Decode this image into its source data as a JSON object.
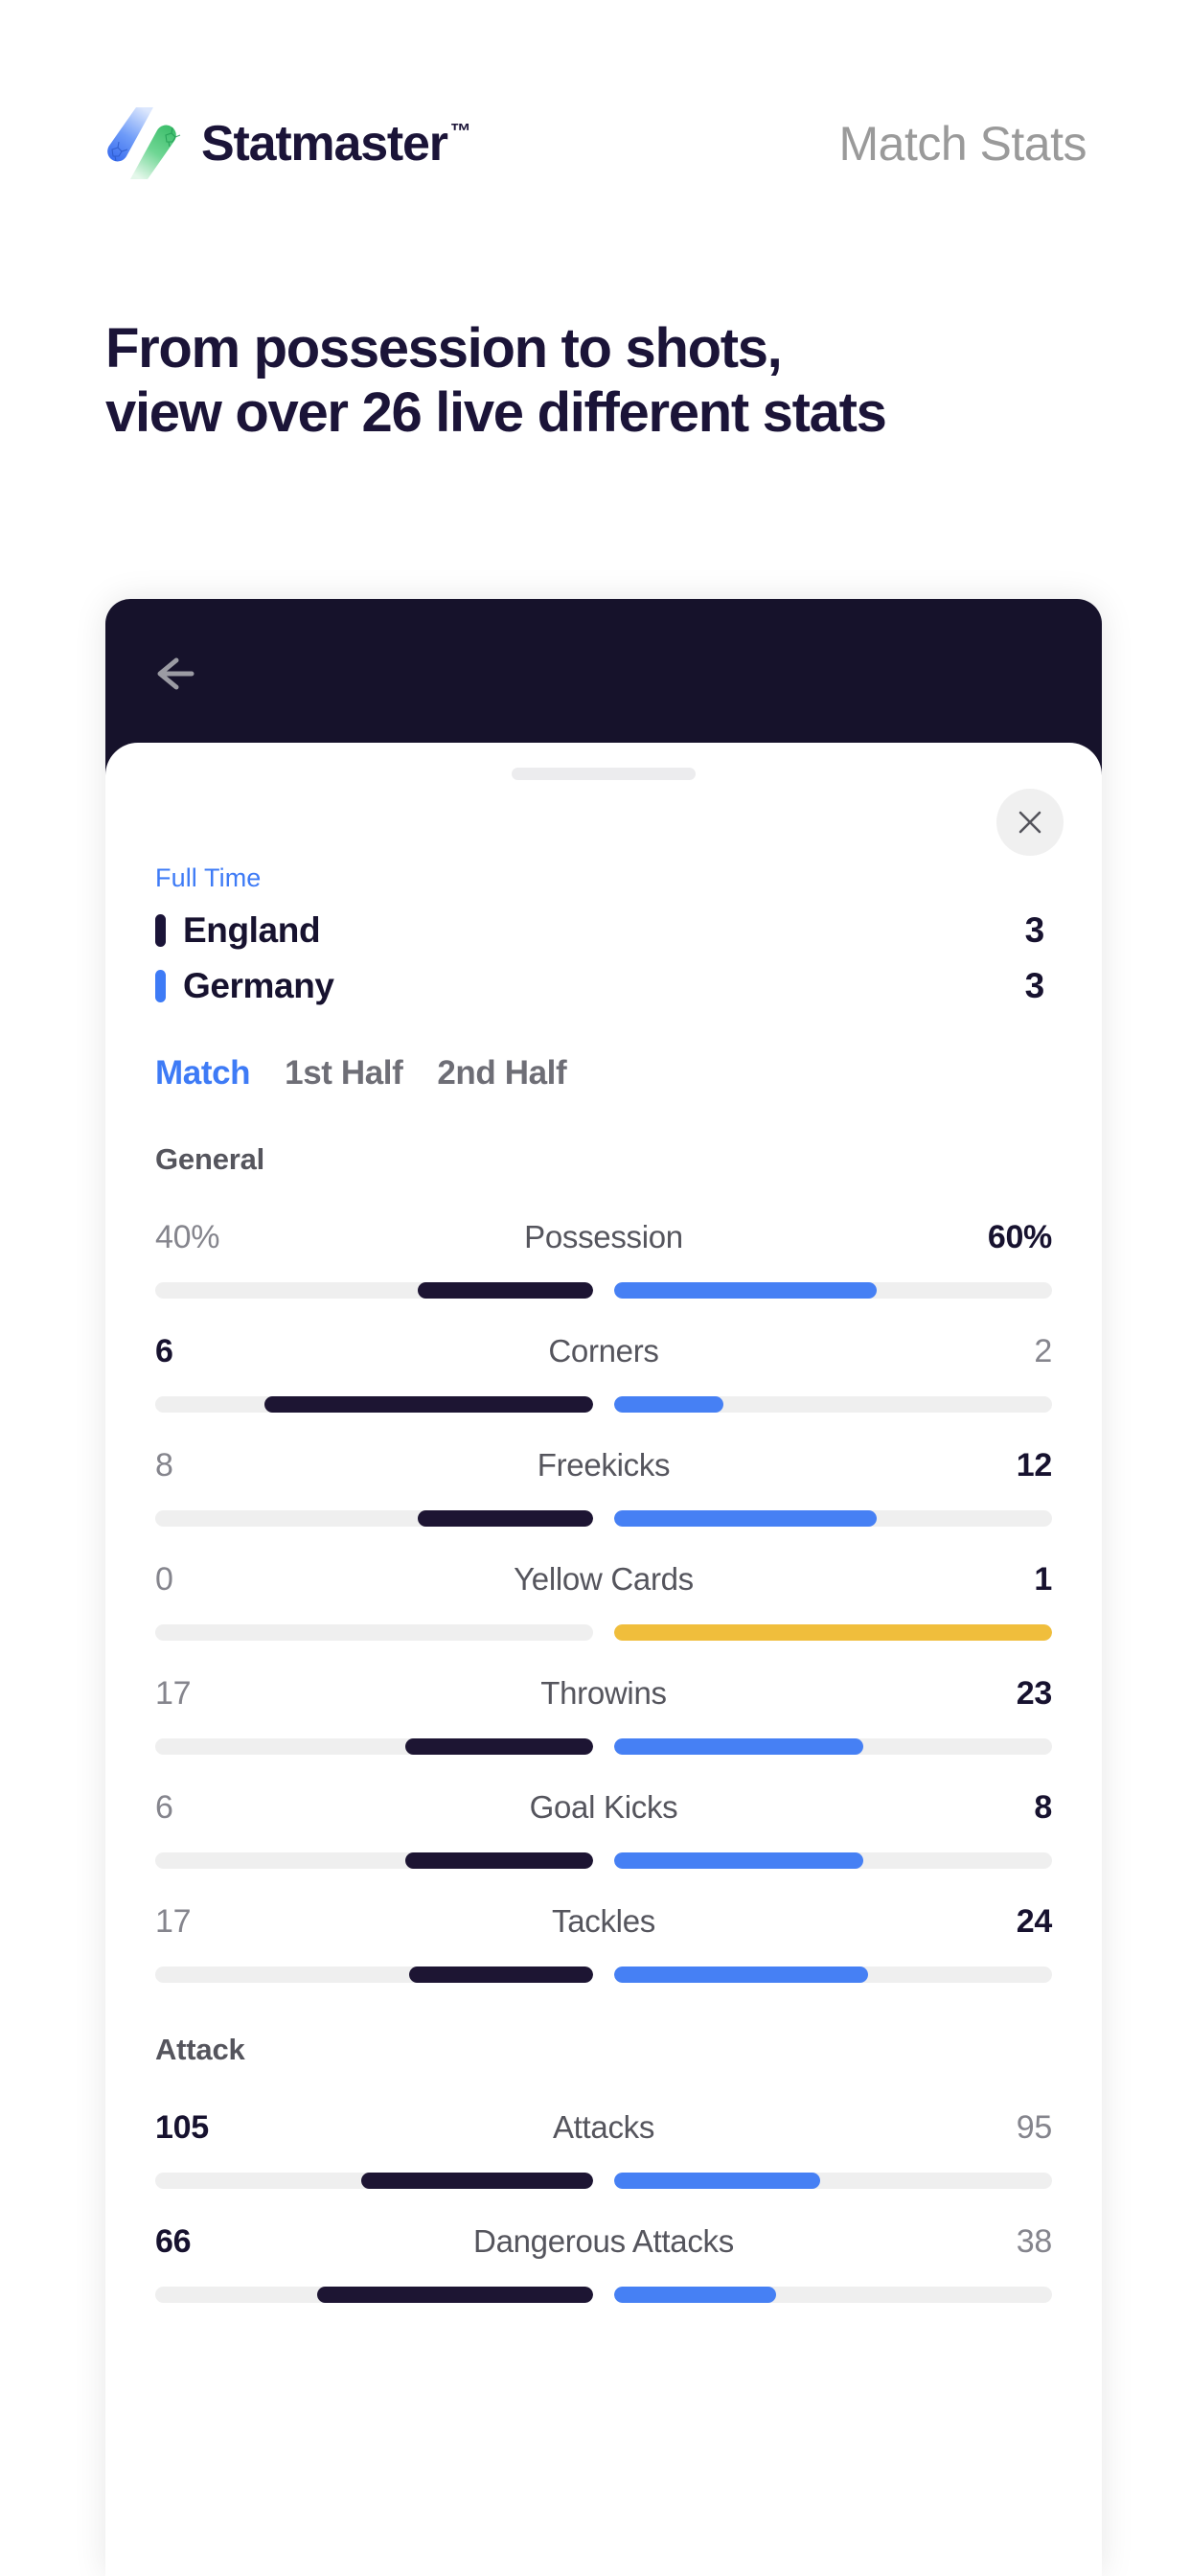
{
  "brand": {
    "name": "Statmaster",
    "tm": "™",
    "logo_icon": "statmaster-slash-logo",
    "colors": {
      "blue": "#4680F4",
      "green": "#3DBE6B",
      "navy": "#1B1438"
    }
  },
  "header": {
    "page_label": "Match Stats"
  },
  "hero": {
    "headline_line1": "From possession to shots,",
    "headline_line2": "view over 26 live different stats"
  },
  "phone": {
    "nav": {
      "back_icon": "arrow-left-icon"
    },
    "sheet": {
      "drag_handle": "drag-handle",
      "close_icon": "close-icon"
    },
    "match": {
      "status": "Full Time",
      "home": {
        "name": "England",
        "score": "3",
        "chip_color": "#1B1438"
      },
      "away": {
        "name": "Germany",
        "score": "3",
        "chip_color": "#3E7BF6"
      }
    },
    "tabs": [
      {
        "label": "Match",
        "active": true
      },
      {
        "label": "1st Half",
        "active": false
      },
      {
        "label": "2nd Half",
        "active": false
      }
    ],
    "groups": [
      {
        "title": "General",
        "stats": [
          {
            "name": "Possession",
            "home": "40%",
            "away": "60%",
            "home_pct": 40,
            "away_pct": 60,
            "home_winner": false,
            "away_winner": true,
            "away_color": "away"
          },
          {
            "name": "Corners",
            "home": "6",
            "away": "2",
            "home_pct": 75,
            "away_pct": 25,
            "home_winner": true,
            "away_winner": false,
            "away_color": "away"
          },
          {
            "name": "Freekicks",
            "home": "8",
            "away": "12",
            "home_pct": 40,
            "away_pct": 60,
            "home_winner": false,
            "away_winner": true,
            "away_color": "away"
          },
          {
            "name": "Yellow Cards",
            "home": "0",
            "away": "1",
            "home_pct": 0,
            "away_pct": 100,
            "home_winner": false,
            "away_winner": true,
            "away_color": "card"
          },
          {
            "name": "Throwins",
            "home": "17",
            "away": "23",
            "home_pct": 43,
            "away_pct": 57,
            "home_winner": false,
            "away_winner": true,
            "away_color": "away"
          },
          {
            "name": "Goal Kicks",
            "home": "6",
            "away": "8",
            "home_pct": 43,
            "away_pct": 57,
            "home_winner": false,
            "away_winner": true,
            "away_color": "away"
          },
          {
            "name": "Tackles",
            "home": "17",
            "away": "24",
            "home_pct": 42,
            "away_pct": 58,
            "home_winner": false,
            "away_winner": true,
            "away_color": "away"
          }
        ]
      },
      {
        "title": "Attack",
        "stats": [
          {
            "name": "Attacks",
            "home": "105",
            "away": "95",
            "home_pct": 53,
            "away_pct": 47,
            "home_winner": true,
            "away_winner": false,
            "away_color": "away"
          },
          {
            "name": "Dangerous Attacks",
            "home": "66",
            "away": "38",
            "home_pct": 63,
            "away_pct": 37,
            "home_winner": true,
            "away_winner": false,
            "away_color": "away"
          }
        ]
      }
    ]
  },
  "chart_data": {
    "type": "bar",
    "title": "Match Stats — England vs Germany (Full Time)",
    "categories": [
      "Possession",
      "Corners",
      "Freekicks",
      "Yellow Cards",
      "Throwins",
      "Goal Kicks",
      "Tackles",
      "Attacks",
      "Dangerous Attacks"
    ],
    "series": [
      {
        "name": "England",
        "values": [
          40,
          6,
          8,
          0,
          17,
          6,
          17,
          105,
          66
        ]
      },
      {
        "name": "Germany",
        "values": [
          60,
          2,
          12,
          1,
          23,
          8,
          24,
          95,
          38
        ]
      }
    ],
    "xlabel": "",
    "ylabel": "",
    "legend": "top",
    "grid": false
  }
}
